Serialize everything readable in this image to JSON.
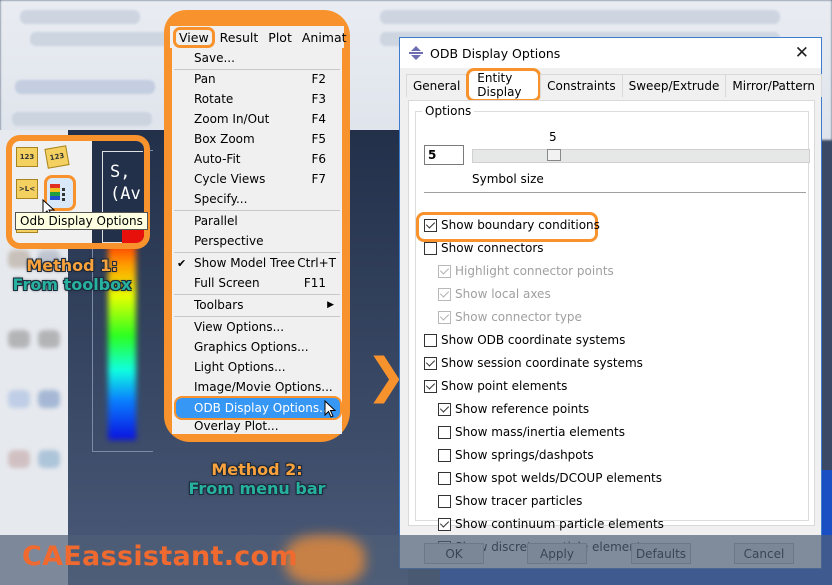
{
  "background": {
    "legend_text": [
      "S,",
      "(Av"
    ]
  },
  "toolbox": {
    "icons": [
      "numbering-icon-123",
      "numbering-icon-123-diagonal",
      "arrows-icon",
      "odb-display-options-icon"
    ],
    "tooltip": "Odb Display Options"
  },
  "method1": {
    "line1": "Method 1:",
    "line2": "From toolbox"
  },
  "method2": {
    "line1": "Method 2:",
    "line2": "From menu bar"
  },
  "menubar": {
    "items": [
      "View",
      "Result",
      "Plot",
      "Animat"
    ]
  },
  "view_menu": {
    "items": [
      {
        "label": "Save...",
        "shortcut": ""
      },
      {
        "label": "Pan",
        "shortcut": "F2"
      },
      {
        "label": "Rotate",
        "shortcut": "F3"
      },
      {
        "label": "Zoom In/Out",
        "shortcut": "F4"
      },
      {
        "label": "Box Zoom",
        "shortcut": "F5"
      },
      {
        "label": "Auto-Fit",
        "shortcut": "F6"
      },
      {
        "label": "Cycle Views",
        "shortcut": "F7"
      },
      {
        "label": "Specify...",
        "shortcut": ""
      },
      {
        "label": "Parallel",
        "shortcut": ""
      },
      {
        "label": "Perspective",
        "shortcut": ""
      },
      {
        "label": "Show Model Tree",
        "shortcut": "Ctrl+T",
        "checked": true
      },
      {
        "label": "Full Screen",
        "shortcut": "F11"
      },
      {
        "label": "Toolbars",
        "shortcut": "",
        "submenu": true
      },
      {
        "label": "View Options...",
        "shortcut": ""
      },
      {
        "label": "Graphics Options...",
        "shortcut": ""
      },
      {
        "label": "Light Options...",
        "shortcut": ""
      },
      {
        "label": "Image/Movie Options...",
        "shortcut": ""
      },
      {
        "label": "ODB Display Options...",
        "shortcut": "",
        "highlighted": true
      },
      {
        "label": "Overlay Plot...",
        "shortcut": ""
      }
    ],
    "checkmark": "✔",
    "submenu_arrow": "▶"
  },
  "dialog": {
    "title": "ODB Display Options",
    "close": "✕",
    "tabs": [
      "General",
      "Entity Display",
      "Constraints",
      "Sweep/Extrude",
      "Mirror/Pattern"
    ],
    "active_tab": "Entity Display",
    "group_label": "Options",
    "symbol_size": {
      "value": "5",
      "slider_label": "5",
      "label": "Symbol size",
      "fraction": 0.22
    },
    "checkboxes": [
      {
        "label": "Show boundary conditions",
        "checked": true,
        "enabled": true
      },
      {
        "label": "Show connectors",
        "checked": false,
        "enabled": true
      },
      {
        "label": "Highlight connector points",
        "checked": true,
        "enabled": false
      },
      {
        "label": "Show local axes",
        "checked": true,
        "enabled": false
      },
      {
        "label": "Show connector type",
        "checked": true,
        "enabled": false
      },
      {
        "label": "Show ODB coordinate systems",
        "checked": false,
        "enabled": true
      },
      {
        "label": "Show session coordinate systems",
        "checked": true,
        "enabled": true
      },
      {
        "label": "Show point elements",
        "checked": true,
        "enabled": true
      },
      {
        "label": "Show reference points",
        "checked": true,
        "enabled": true
      },
      {
        "label": "Show mass/inertia elements",
        "checked": false,
        "enabled": true
      },
      {
        "label": "Show springs/dashpots",
        "checked": false,
        "enabled": true
      },
      {
        "label": "Show spot welds/DCOUP elements",
        "checked": false,
        "enabled": true
      },
      {
        "label": "Show tracer particles",
        "checked": false,
        "enabled": true
      },
      {
        "label": "Show continuum particle elements",
        "checked": true,
        "enabled": true
      },
      {
        "label": "Show discrete particle elements",
        "checked": true,
        "enabled": true
      }
    ],
    "buttons": [
      "OK",
      "Apply",
      "Defaults",
      "Cancel"
    ]
  },
  "watermark": "CAEassistant.com",
  "colors": {
    "highlight": "#f7922c",
    "menu_selection": "#3797f4",
    "method_title": "#f7a23c",
    "method_sub": "#27b2a0",
    "watermark": "#f06a30"
  }
}
